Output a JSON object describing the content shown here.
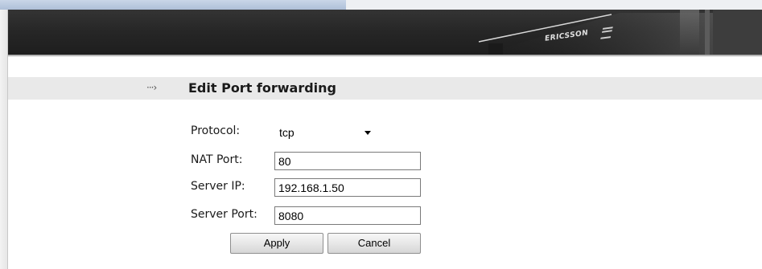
{
  "branding": {
    "logo_text": "ERICSSON"
  },
  "page": {
    "title": "Edit Port forwarding"
  },
  "form": {
    "protocol": {
      "label": "Protocol:",
      "selected": "tcp"
    },
    "nat_port": {
      "label": "NAT Port:",
      "value": "80"
    },
    "server_ip": {
      "label": "Server IP:",
      "value": "192.168.1.50"
    },
    "server_port": {
      "label": "Server Port:",
      "value": "8080"
    }
  },
  "buttons": {
    "apply_label": "Apply",
    "cancel_label": "Cancel"
  },
  "icons": {
    "title_arrow": "arrow-right-icon",
    "dropdown": "chevron-down-icon"
  },
  "colors": {
    "banner_bg": "#262626",
    "title_bar_bg": "#e9e9e9"
  }
}
